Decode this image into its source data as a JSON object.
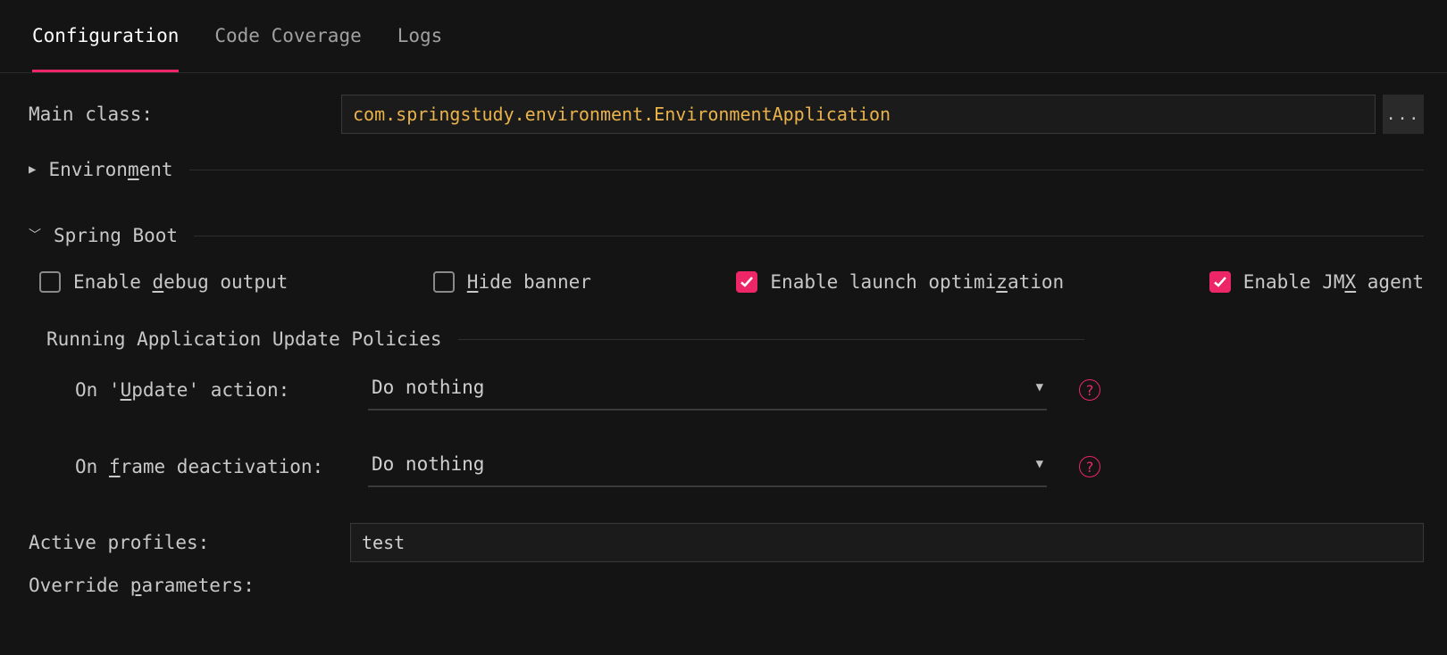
{
  "tabs": {
    "configuration": "Configuration",
    "coverage": "Code Coverage",
    "logs": "Logs"
  },
  "main": {
    "mainClassLabel": "Main class:",
    "mainClassValue": "com.springstudy.environment.EnvironmentApplication",
    "browseGlyph": "..."
  },
  "env": {
    "title": "Environment"
  },
  "spring": {
    "title": "Spring Boot",
    "checks": {
      "debug": "Enable debug output",
      "hide": "Hide banner",
      "launch": "Enable launch optimization",
      "jmx": "Enable JMX agent"
    },
    "policies": {
      "title": "Running Application Update Policies",
      "updateLabel": "On 'Update' action:",
      "updateValue": "Do nothing",
      "frameLabel": "On frame deactivation:",
      "frameValue": "Do nothing",
      "helpGlyph": "?"
    }
  },
  "profiles": {
    "label": "Active profiles:",
    "value": "test"
  },
  "override": {
    "label": "Override parameters:"
  }
}
